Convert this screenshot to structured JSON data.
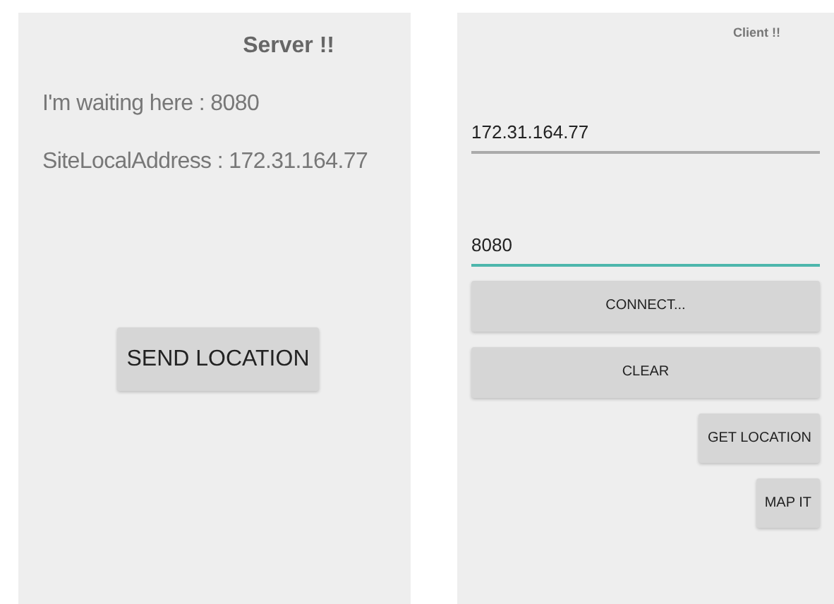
{
  "server": {
    "title": "Server !!",
    "lines": [
      "I'm waiting here : 8080",
      "SiteLocalAddress : 172.31.164.77"
    ],
    "button": "SEND LOCATION"
  },
  "client": {
    "title": "Client !!",
    "fields": [
      {
        "value": "172.31.164.77",
        "focused": false
      },
      {
        "value": "8080",
        "focused": true
      }
    ],
    "buttons": [
      {
        "label": "CONNECT...",
        "kind": "wide"
      },
      {
        "label": "CLEAR",
        "kind": "wide"
      },
      {
        "label": "GET LOCATION",
        "kind": "small"
      },
      {
        "label": "MAP IT",
        "kind": "small"
      }
    ]
  }
}
